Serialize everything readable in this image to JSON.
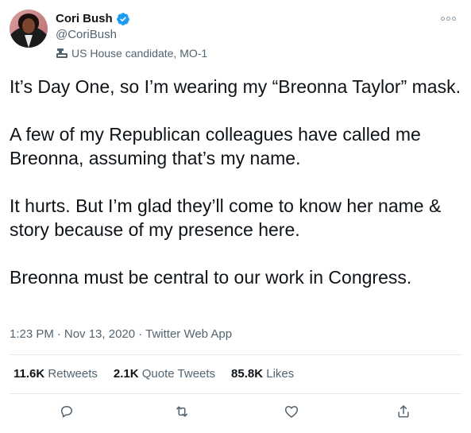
{
  "author": {
    "name": "Cori Bush",
    "handle": "@CoriBush",
    "label": "US House candidate, MO-1"
  },
  "tweet": {
    "paragraphs": [
      "It’s Day One, so I’m wearing my “Breonna Taylor” mask.",
      "A few of my Republican colleagues have called me Breonna, assuming that’s my name.",
      "It hurts. But I’m glad they’ll come to know her name & story because of my presence here.",
      "Breonna must be central to our work in Congress."
    ],
    "time": "1:23 PM",
    "date": "Nov 13, 2020",
    "source": "Twitter Web App",
    "separator": "·"
  },
  "stats": {
    "retweets": {
      "count": "11.6K",
      "label": "Retweets"
    },
    "quotes": {
      "count": "2.1K",
      "label": "Quote Tweets"
    },
    "likes": {
      "count": "85.8K",
      "label": "Likes"
    }
  },
  "icons": {
    "verified": "verified-badge-icon",
    "label": "government-building-icon",
    "more": "more-options-icon",
    "reply": "reply-icon",
    "retweet": "retweet-icon",
    "like": "heart-icon",
    "share": "share-icon"
  },
  "colors": {
    "verified_blue": "#1d9bf0",
    "text": "#0f1419",
    "secondary": "#536471",
    "divider": "#e1e8ed"
  }
}
